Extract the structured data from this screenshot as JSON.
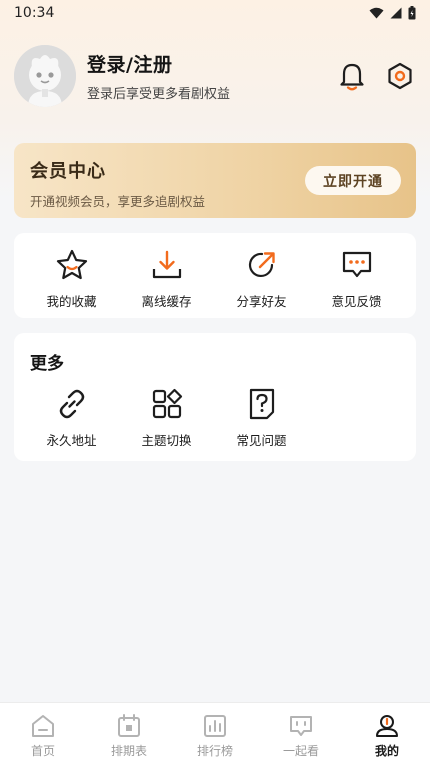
{
  "status_bar": {
    "time": "10:34"
  },
  "profile": {
    "title": "登录/注册",
    "subtitle": "登录后享受更多看剧权益"
  },
  "vip": {
    "title": "会员中心",
    "subtitle": "开通视频会员，享更多追剧权益",
    "button": "立即开通"
  },
  "quick_actions": [
    {
      "label": "我的收藏",
      "icon": "star-icon"
    },
    {
      "label": "离线缓存",
      "icon": "download-icon"
    },
    {
      "label": "分享好友",
      "icon": "share-icon"
    },
    {
      "label": "意见反馈",
      "icon": "feedback-icon"
    }
  ],
  "more": {
    "title": "更多",
    "items": [
      {
        "label": "永久地址",
        "icon": "link-icon"
      },
      {
        "label": "主题切换",
        "icon": "theme-icon"
      },
      {
        "label": "常见问题",
        "icon": "faq-icon"
      }
    ]
  },
  "tabbar": {
    "items": [
      {
        "label": "首页",
        "icon": "home-icon"
      },
      {
        "label": "排期表",
        "icon": "calendar-icon"
      },
      {
        "label": "排行榜",
        "icon": "chart-icon"
      },
      {
        "label": "一起看",
        "icon": "chat-icon"
      },
      {
        "label": "我的",
        "icon": "profile-icon",
        "active": true
      }
    ]
  },
  "colors": {
    "accent": "#f26b1d",
    "background": "#f5f6f8",
    "vip_gold": "#e7c389"
  }
}
